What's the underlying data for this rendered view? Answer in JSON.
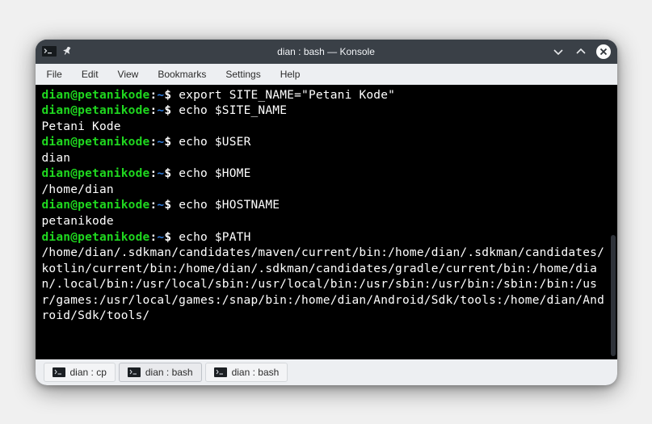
{
  "window": {
    "title": "dian : bash — Konsole"
  },
  "menubar": {
    "items": [
      "File",
      "Edit",
      "View",
      "Bookmarks",
      "Settings",
      "Help"
    ]
  },
  "prompt": {
    "user_host": "dian@petanikode",
    "colon": ":",
    "path": "~",
    "dollar": "$"
  },
  "session": [
    {
      "cmd": "export SITE_NAME=\"Petani Kode\"",
      "out": null
    },
    {
      "cmd": "echo $SITE_NAME",
      "out": "Petani Kode"
    },
    {
      "cmd": "echo $USER",
      "out": "dian"
    },
    {
      "cmd": "echo $HOME",
      "out": "/home/dian"
    },
    {
      "cmd": "echo $HOSTNAME",
      "out": "petanikode"
    },
    {
      "cmd": "echo $PATH",
      "out": "/home/dian/.sdkman/candidates/maven/current/bin:/home/dian/.sdkman/candidates/kotlin/current/bin:/home/dian/.sdkman/candidates/gradle/current/bin:/home/dian/.local/bin:/usr/local/sbin:/usr/local/bin:/usr/sbin:/usr/bin:/sbin:/bin:/usr/games:/usr/local/games:/snap/bin:/home/dian/Android/Sdk/tools:/home/dian/Android/Sdk/tools/"
    }
  ],
  "tabs": [
    {
      "label": "dian : cp",
      "active": false
    },
    {
      "label": "dian : bash",
      "active": true
    },
    {
      "label": "dian : bash",
      "active": false
    }
  ]
}
